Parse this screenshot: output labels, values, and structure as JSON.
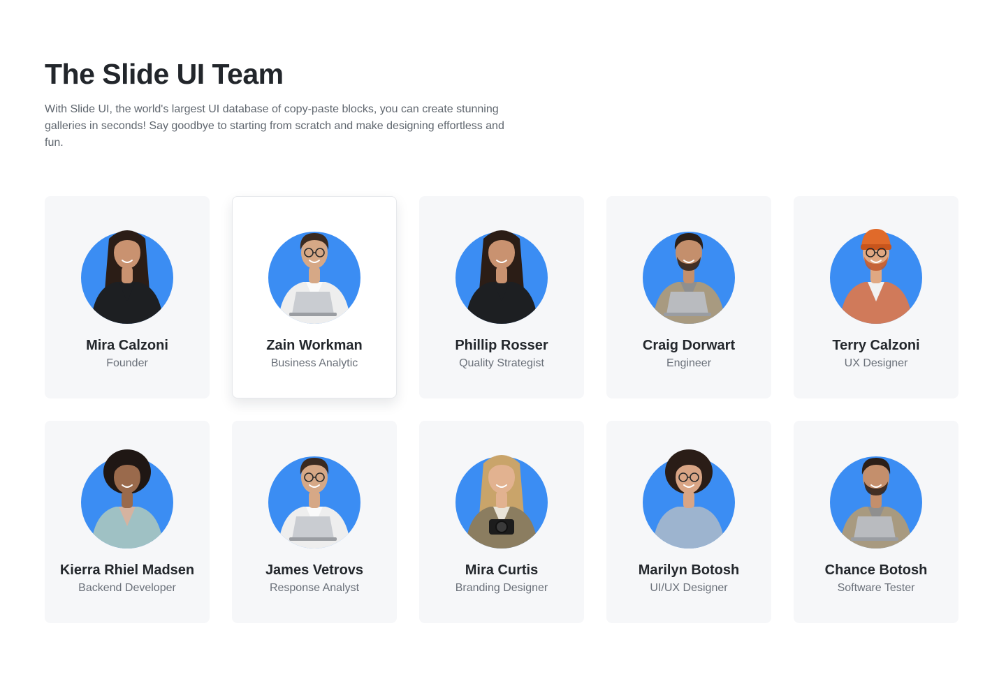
{
  "header": {
    "title": "The Slide UI Team",
    "description": "With Slide UI, the world's largest UI database of copy-paste blocks, you can create stunning galleries in seconds! Say goodbye to starting from scratch and make designing effortless and fun."
  },
  "colors": {
    "avatar_background": "#3b8df3",
    "card_background": "#f6f7f9",
    "active_card_background": "#ffffff"
  },
  "team": [
    {
      "name": "Mira Calzoni",
      "role": "Founder",
      "avatar": "woman-dark-hair-black-shirt",
      "active": false
    },
    {
      "name": "Zain Workman",
      "role": "Business Analytic",
      "avatar": "man-glasses-white-jacket-laptop",
      "active": true
    },
    {
      "name": "Phillip Rosser",
      "role": "Quality Strategist",
      "avatar": "woman-dark-hair-black-shirt",
      "active": false
    },
    {
      "name": "Craig Dorwart",
      "role": "Engineer",
      "avatar": "man-beige-jacket-laptop",
      "active": false
    },
    {
      "name": "Terry Calzoni",
      "role": "UX Designer",
      "avatar": "man-orange-beanie-floral-shirt",
      "active": false
    },
    {
      "name": "Kierra Rhiel Madsen",
      "role": "Backend Developer",
      "avatar": "woman-curly-hair-floral-blouse",
      "active": false
    },
    {
      "name": "James Vetrovs",
      "role": "Response Analyst",
      "avatar": "man-glasses-white-jacket-laptop",
      "active": false
    },
    {
      "name": "Mira Curtis",
      "role": "Branding Designer",
      "avatar": "woman-blonde-camera",
      "active": false
    },
    {
      "name": "Marilyn Botosh",
      "role": "UI/UX Designer",
      "avatar": "woman-glasses-blue-shirt",
      "active": false
    },
    {
      "name": "Chance Botosh",
      "role": "Software Tester",
      "avatar": "man-beige-jacket-laptop",
      "active": false
    }
  ]
}
